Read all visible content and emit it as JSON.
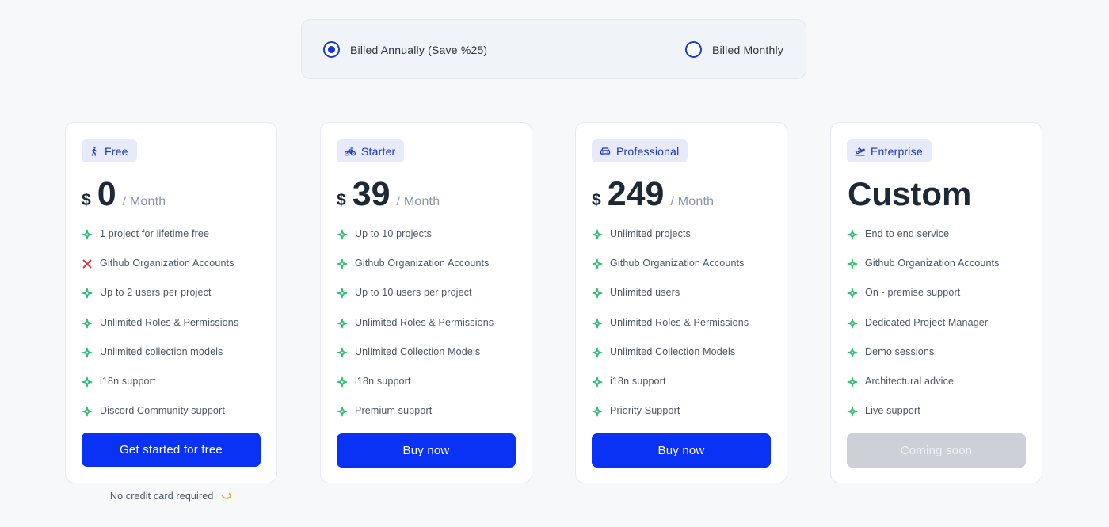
{
  "billing": {
    "annual_label": "Billed Annually (Save %25)",
    "monthly_label": "Billed Monthly",
    "selected": "annual"
  },
  "colors": {
    "accent": "#0a32f5",
    "check": "#2fbf71",
    "cross": "#e5393c",
    "badge_bg": "#e6eafb",
    "disabled": "#cdd0d7"
  },
  "plans": [
    {
      "name": "Free",
      "icon": "walking-person-icon",
      "currency": "$",
      "price": "0",
      "period": "/ Month",
      "features": [
        {
          "text": "1 project for lifetime free",
          "included": true
        },
        {
          "text": "Github Organization Accounts",
          "included": false
        },
        {
          "text": "Up to 2 users per project",
          "included": true
        },
        {
          "text": "Unlimited Roles & Permissions",
          "included": true
        },
        {
          "text": "Unlimited collection models",
          "included": true
        },
        {
          "text": "i18n support",
          "included": true
        },
        {
          "text": "Discord Community support",
          "included": true
        }
      ],
      "cta": "Get started for free"
    },
    {
      "name": "Starter",
      "icon": "bicycle-icon",
      "currency": "$",
      "price": "39",
      "period": "/ Month",
      "features": [
        {
          "text": "Up to 10 projects",
          "included": true
        },
        {
          "text": "Github Organization Accounts",
          "included": true
        },
        {
          "text": "Up to 10 users per project",
          "included": true
        },
        {
          "text": "Unlimited Roles & Permissions",
          "included": true
        },
        {
          "text": "Unlimited Collection Models",
          "included": true
        },
        {
          "text": "i18n support",
          "included": true
        },
        {
          "text": "Premium support",
          "included": true
        }
      ],
      "cta": "Buy now"
    },
    {
      "name": "Professional",
      "icon": "car-icon",
      "currency": "$",
      "price": "249",
      "period": "/ Month",
      "features": [
        {
          "text": "Unlimited projects",
          "included": true
        },
        {
          "text": "Github Organization Accounts",
          "included": true
        },
        {
          "text": "Unlimited users",
          "included": true
        },
        {
          "text": "Unlimited Roles & Permissions",
          "included": true
        },
        {
          "text": "Unlimited Collection Models",
          "included": true
        },
        {
          "text": "i18n support",
          "included": true
        },
        {
          "text": "Priority Support",
          "included": true
        }
      ],
      "cta": "Buy now"
    },
    {
      "name": "Enterprise",
      "icon": "airplane-takeoff-icon",
      "price": "Custom",
      "features": [
        {
          "text": "End to end service",
          "included": true
        },
        {
          "text": "Github Organization Accounts",
          "included": true
        },
        {
          "text": "On - premise support",
          "included": true
        },
        {
          "text": "Dedicated Project Manager",
          "included": true
        },
        {
          "text": "Demo sessions",
          "included": true
        },
        {
          "text": "Architectural advice",
          "included": true
        },
        {
          "text": "Live support",
          "included": true
        }
      ],
      "cta": "Coming soon",
      "cta_disabled": true
    }
  ],
  "footer_note": "No credit card required"
}
